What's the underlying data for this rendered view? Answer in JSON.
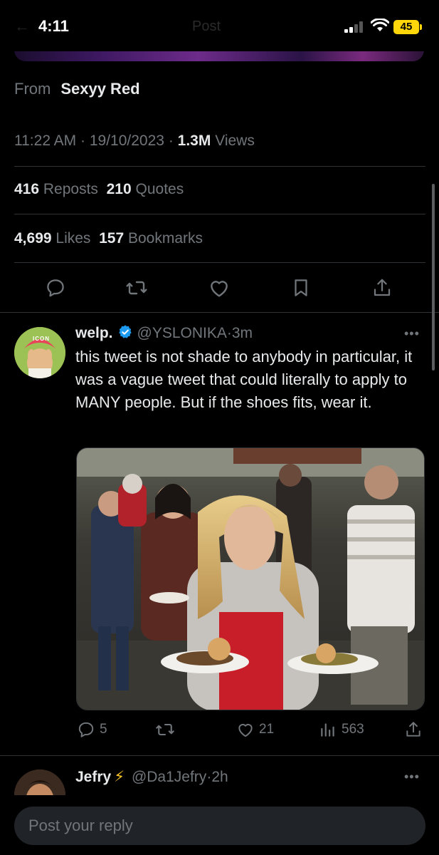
{
  "status_bar": {
    "time": "4:11",
    "battery": "45",
    "faded_title": "Post"
  },
  "post_meta": {
    "from_label": "From",
    "from_source": "Sexyy Red",
    "time": "11:22 AM",
    "date": "19/10/2023",
    "views_count": "1.3M",
    "views_label": "Views",
    "separator": "·"
  },
  "stats": {
    "reposts_count": "416",
    "reposts_label": "Reposts",
    "quotes_count": "210",
    "quotes_label": "Quotes",
    "likes_count": "4,699",
    "likes_label": "Likes",
    "bookmarks_count": "157",
    "bookmarks_label": "Bookmarks"
  },
  "actions": [
    "reply-icon",
    "repost-icon",
    "like-icon",
    "bookmark-icon",
    "share-icon"
  ],
  "reply_tweet": {
    "name": "welp.",
    "handle": "@YSLONIKA",
    "time": "3m",
    "avatar_text": "ICON",
    "text": "this tweet is not shade to anybody in particular, it was a vague tweet that could literally to apply to MANY people. But if the shoes fits, wear it.",
    "engagement": {
      "replies": "5",
      "reposts": "",
      "likes": "21",
      "views": "563"
    }
  },
  "next_tweet": {
    "name": "Jefry",
    "emoji": "⚡",
    "handle": "@Da1Jefry",
    "time": "2h"
  },
  "reply_bar": {
    "placeholder": "Post your reply"
  },
  "colors": {
    "background": "#000000",
    "text": "#e7e9ea",
    "muted": "#71767b",
    "divider": "#2f3336",
    "verified": "#1d9bf0",
    "battery": "#ffd60a"
  }
}
